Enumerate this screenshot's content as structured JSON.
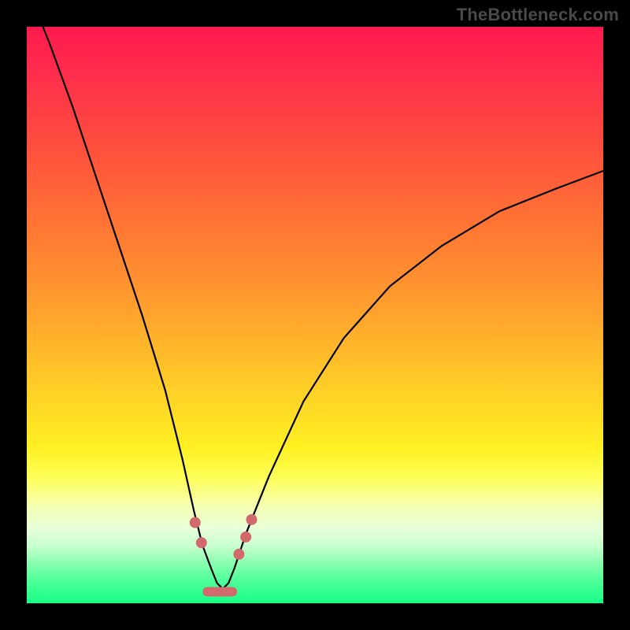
{
  "branding": {
    "text": "TheBottleneck.com"
  },
  "colors": {
    "frame": "#000000",
    "curve": "#000000",
    "marker": "#d2696c",
    "gradient_top": "#ff1a4d",
    "gradient_bottom": "#17ff87"
  },
  "chart_data": {
    "type": "line",
    "title": "",
    "xlabel": "",
    "ylabel": "",
    "xlim": [
      0,
      100
    ],
    "ylim": [
      0,
      100
    ],
    "grid": false,
    "legend": false,
    "notes": "V-shaped bottleneck curve on rainbow gradient. Y is plotted with 0 at bottom, 100 at top. Minimum region highlighted with salmon markers and a short horizontal bar near the bottom.",
    "series": [
      {
        "name": "bottleneck_curve",
        "x": [
          0,
          4,
          8,
          12,
          16,
          20,
          24,
          27,
          29,
          30.5,
          32,
          33,
          34,
          35,
          36,
          38,
          42,
          48,
          55,
          63,
          72,
          82,
          92,
          100
        ],
        "values": [
          107,
          97,
          86,
          74,
          62,
          50,
          37,
          25,
          16,
          10,
          6,
          3.5,
          2.5,
          3.5,
          6,
          12,
          22,
          35,
          46,
          55,
          62,
          68,
          72,
          75
        ]
      }
    ],
    "markers": {
      "name": "optimum_points",
      "x": [
        29.2,
        30.3,
        36.8,
        38.0,
        39.0
      ],
      "values": [
        14.0,
        10.5,
        8.5,
        11.5,
        14.5
      ],
      "radius": 7
    },
    "optimum_bar": {
      "x_start": 30.5,
      "x_end": 36.5,
      "y": 2.0,
      "thickness": 12
    }
  }
}
